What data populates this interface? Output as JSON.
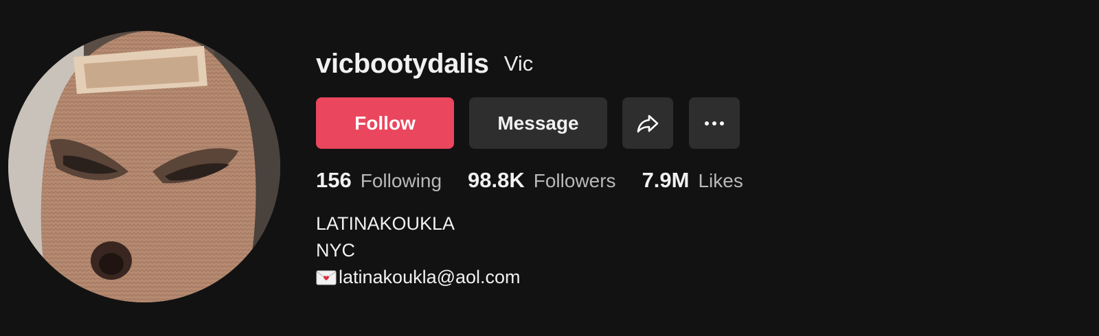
{
  "profile": {
    "username": "vicbootydalis",
    "nickname": "Vic"
  },
  "actions": {
    "follow_label": "Follow",
    "message_label": "Message",
    "share_icon": "share-arrow-icon",
    "more_icon": "more-horizontal-icon"
  },
  "stats": [
    {
      "value": "156",
      "label": "Following"
    },
    {
      "value": "98.8K",
      "label": "Followers"
    },
    {
      "value": "7.9M",
      "label": "Likes"
    }
  ],
  "bio": {
    "line1": "LATINAKOUKLA",
    "line2": "NYC",
    "email": "latinakoukla@aol.com",
    "email_icon": "love-letter-envelope-icon"
  },
  "colors": {
    "background": "#121212",
    "follow_button": "#ea465e",
    "secondary_button": "#2e2e2e"
  }
}
